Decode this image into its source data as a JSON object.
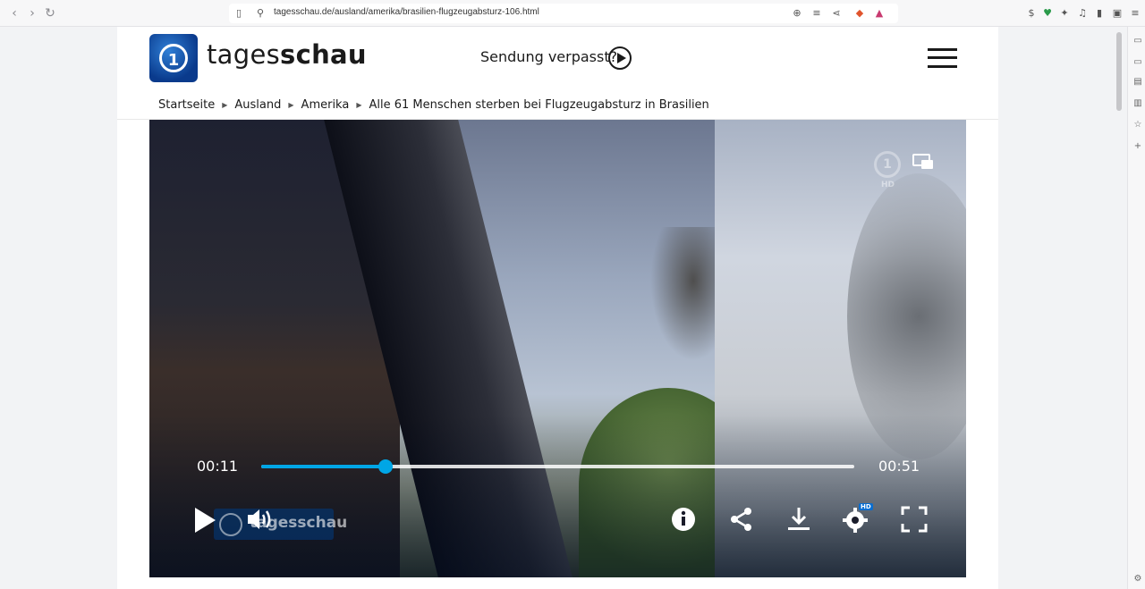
{
  "browser": {
    "url": "tagesschau.de/ausland/amerika/brasilien-flugzeugabsturz-106.html"
  },
  "header": {
    "brand_light": "tages",
    "brand_bold": "schau",
    "sendung_label": "Sendung verpasst?"
  },
  "breadcrumb": {
    "items": [
      "Startseite",
      "Ausland",
      "Amerika",
      "Alle 61 Menschen sterben bei Flugzeugabsturz in Brasilien"
    ]
  },
  "player": {
    "current_time": "00:11",
    "duration": "00:51",
    "progress_fraction": 0.21,
    "watermark_hd": "HD",
    "settings_badge": "HD",
    "overlay_text": "tagesschau",
    "accent_color": "#00a6e6"
  },
  "icons": {
    "back": "arrow-left-icon",
    "forward": "arrow-right-icon",
    "reload": "reload-icon",
    "bookmark": "bookmark-icon",
    "zoom": "zoom-icon",
    "reader": "reader-icon",
    "share": "share-icon",
    "play": "play-icon",
    "volume": "volume-icon",
    "info": "info-icon",
    "download": "download-icon",
    "settings": "gear-icon",
    "fullscreen": "fullscreen-icon",
    "pip": "picture-in-picture-icon"
  }
}
